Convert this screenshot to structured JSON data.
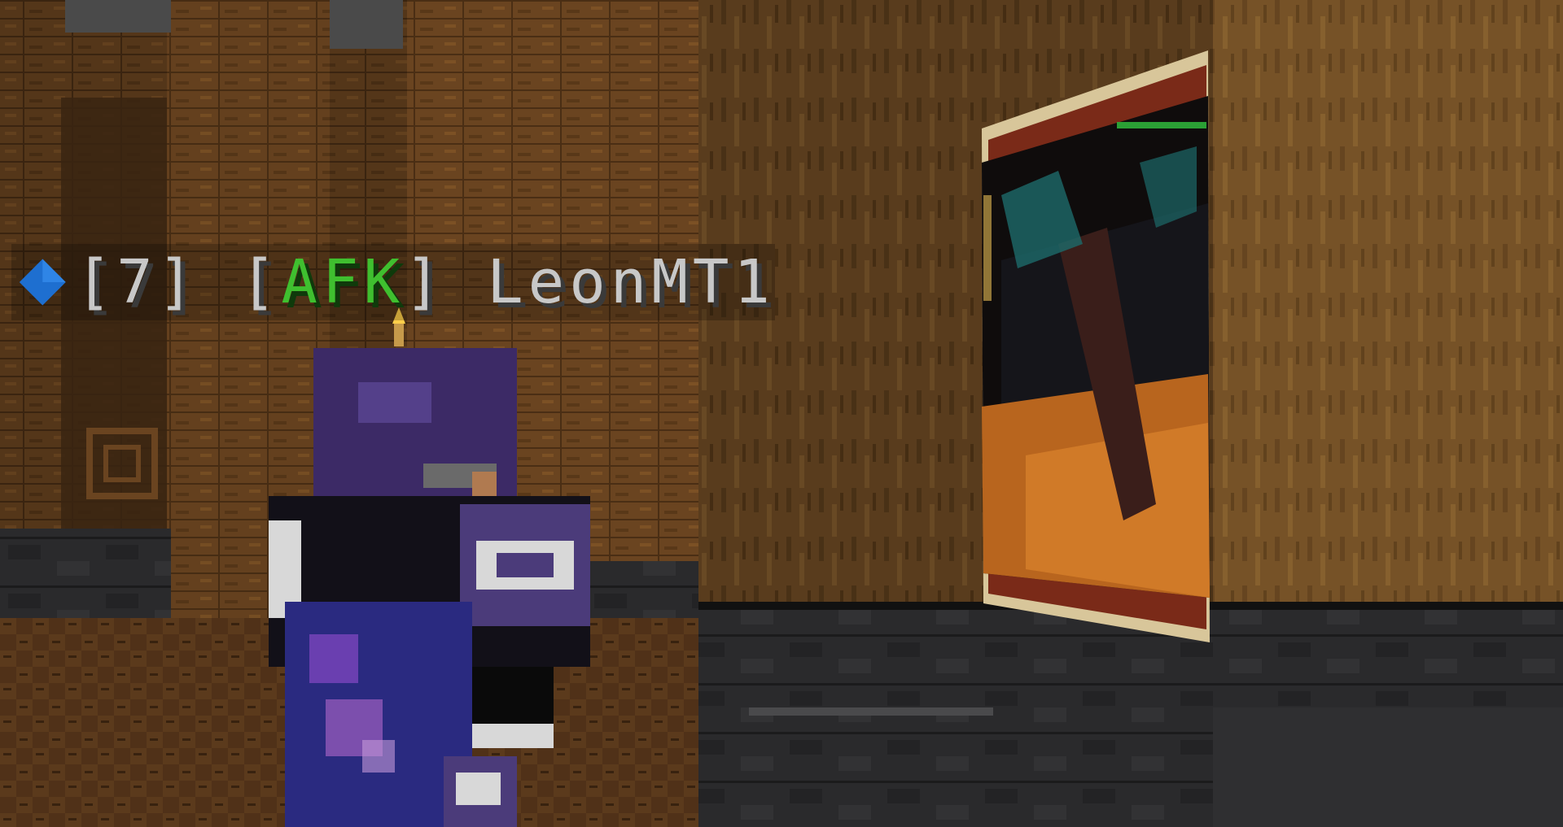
{
  "nametag": {
    "level": "[7]",
    "status_open": "[",
    "status": "AFK",
    "status_close": "]",
    "player_name": "LeonMT1",
    "rank_icon": "blue-diamond-icon",
    "status_color": "#3fbf2f",
    "icon_color": "#1e6fd0"
  }
}
